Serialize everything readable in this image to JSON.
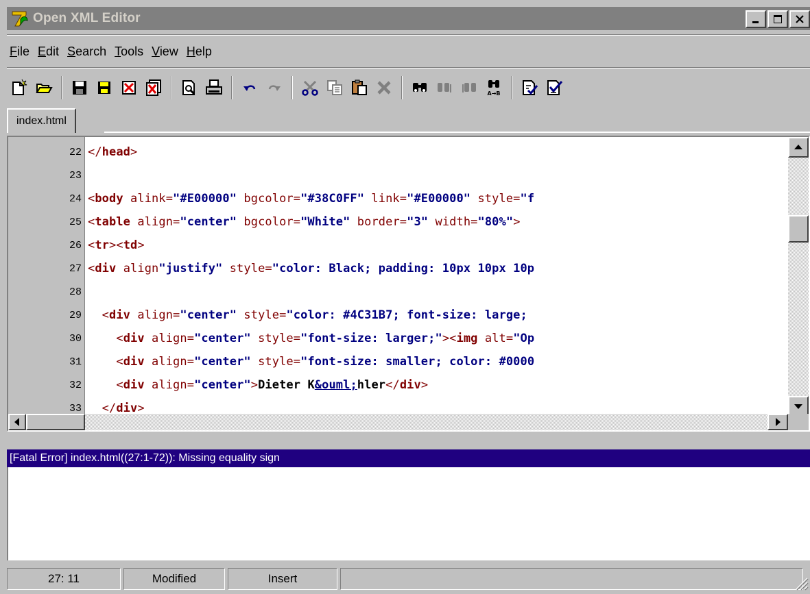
{
  "window": {
    "title": "Open XML Editor",
    "minimize_label": "minimize",
    "maximize_label": "maximize",
    "close_label": "close"
  },
  "menu": [
    {
      "label": "File",
      "accel": "F",
      "rest": "ile"
    },
    {
      "label": "Edit",
      "accel": "E",
      "rest": "dit"
    },
    {
      "label": "Search",
      "accel": "S",
      "rest": "earch"
    },
    {
      "label": "Tools",
      "accel": "T",
      "rest": "ools"
    },
    {
      "label": "View",
      "accel": "V",
      "rest": "iew"
    },
    {
      "label": "Help",
      "accel": "H",
      "rest": "elp"
    }
  ],
  "toolbar": {
    "icons": [
      "new-file-icon",
      "open-folder-icon",
      "save-icon",
      "save-all-icon",
      "close-file-icon",
      "close-all-icon",
      "print-preview-icon",
      "print-icon",
      "undo-icon",
      "redo-icon",
      "cut-icon",
      "copy-icon",
      "paste-icon",
      "delete-icon",
      "find-icon",
      "find-next-icon",
      "find-previous-icon",
      "replace-icon",
      "check-wellformed-icon",
      "validate-icon"
    ]
  },
  "tabs": [
    {
      "label": "index.html",
      "active": true
    }
  ],
  "editor": {
    "lines": [
      {
        "num": "22"
      },
      {
        "num": "23"
      },
      {
        "num": "24"
      },
      {
        "num": "25"
      },
      {
        "num": "26"
      },
      {
        "num": "27"
      },
      {
        "num": "28"
      },
      {
        "num": "29"
      },
      {
        "num": "30"
      },
      {
        "num": "31"
      },
      {
        "num": "32"
      },
      {
        "num": "33"
      }
    ],
    "code": {
      "l22": {
        "t1": "</",
        "t2": "head",
        "t3": ">"
      },
      "l24": {
        "open": "<",
        "tag": "body",
        "a1": " alink=",
        "v1": "\"#E00000\"",
        "a2": " bgcolor=",
        "v2": "\"#38C0FF\"",
        "a3": " link=",
        "v3": "\"#E00000\"",
        "a4": " style=",
        "v4": "\"f"
      },
      "l25": {
        "open": "<",
        "tag": "table",
        "a1": " align=",
        "v1": "\"center\"",
        "a2": " bgcolor=",
        "v2": "\"White\"",
        "a3": " border=",
        "v3": "\"3\"",
        "a4": " width=",
        "v4": "\"80%\"",
        "close": ">"
      },
      "l26": {
        "o1": "<",
        "t1": "tr",
        "c1": "><",
        "t2": "td",
        "c2": ">"
      },
      "l27": {
        "open": "<",
        "tag": "div",
        "a1": " align",
        "v1": "\"justify\"",
        "a2": " style=",
        "v2": "\"color: Black; padding: 10px 10px 10p"
      },
      "l29": {
        "indent": "  ",
        "open": "<",
        "tag": "div",
        "a1": " align=",
        "v1": "\"center\"",
        "a2": " style=",
        "v2": "\"color: #4C31B7; font-size: large;"
      },
      "l30": {
        "indent": "    ",
        "open": "<",
        "tag": "div",
        "a1": " align=",
        "v1": "\"center\"",
        "a2": " style=",
        "v2": "\"font-size: larger;\"",
        "c1": "><",
        "t2": "img",
        "a3": " alt=",
        "v3": "\"Op"
      },
      "l31": {
        "indent": "    ",
        "open": "<",
        "tag": "div",
        "a1": " align=",
        "v1": "\"center\"",
        "a2": " style=",
        "v2": "\"font-size: smaller; color: #0000"
      },
      "l32": {
        "indent": "    ",
        "open": "<",
        "tag": "div",
        "a1": " align=",
        "v1": "\"center\"",
        "c1": ">",
        "txt1": "Dieter K",
        "ent": "&ouml;",
        "txt2": "hler",
        "c2": "</",
        "t2": "div",
        "c3": ">"
      },
      "l33": {
        "indent": "  ",
        "open": "</",
        "tag": "div",
        "close": ">"
      }
    }
  },
  "messages": {
    "header": "[Fatal Error] index.html((27:1-72)): Missing equality sign"
  },
  "status": {
    "position": "27: 11",
    "state": "Modified",
    "mode": "Insert"
  },
  "colors": {
    "tag": "#800000",
    "value": "#000080",
    "message_header": "#1f0080"
  }
}
